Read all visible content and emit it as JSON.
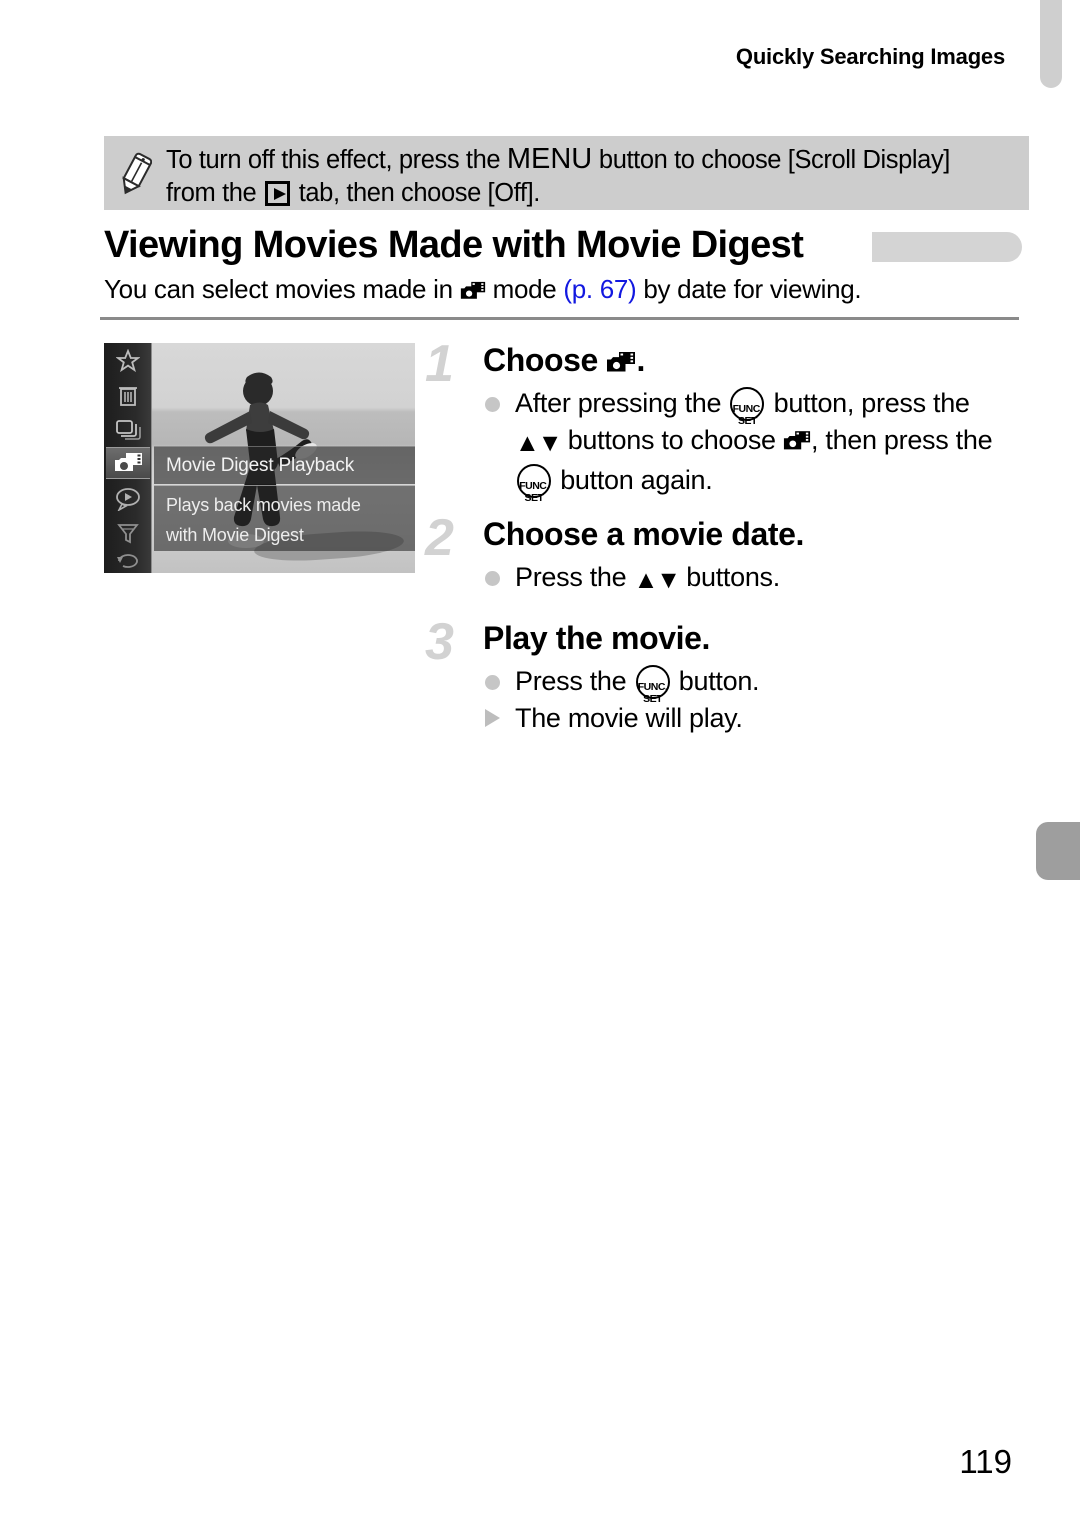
{
  "header": {
    "running_title": "Quickly Searching Images"
  },
  "note": {
    "icon": "pencil-icon",
    "line1_pre": "To turn off this effect, press the ",
    "menu_word": "MENU",
    "line1_post": " button to choose [Scroll Display]",
    "line2_pre": "from the ",
    "tab_icon": "playback-tab-icon",
    "line2_post": " tab, then choose [Off]."
  },
  "section": {
    "heading": "Viewing Movies Made with Movie Digest",
    "sub_pre": "You can select movies made in ",
    "sub_mode_icon": "movie-digest-icon",
    "sub_mid": " mode ",
    "page_ref": "(p. 67)",
    "sub_post": " by date for viewing."
  },
  "camera_screen": {
    "menu_title": "Movie Digest Playback",
    "menu_description_line1": "Plays back movies made",
    "menu_description_line2": "with Movie Digest",
    "sidebar_icons": [
      "star-icon",
      "trash-icon",
      "image-stack-icon",
      "movie-digest-icon",
      "speech-bubble-play-icon",
      "funnel-filter-icon",
      "rotate-icon"
    ]
  },
  "steps": [
    {
      "number": "1",
      "title_pre": "Choose ",
      "title_icon": "movie-digest-icon",
      "title_post": ".",
      "lines": [
        {
          "bullet": "dot",
          "segments": [
            {
              "t": "text",
              "v": "After pressing the "
            },
            {
              "t": "funcset",
              "v": "FUNC./SET"
            },
            {
              "t": "text",
              "v": " button, press the"
            }
          ]
        },
        {
          "bullet": "none",
          "segments": [
            {
              "t": "arrows",
              "v": "▲▼"
            },
            {
              "t": "text",
              "v": " buttons to choose "
            },
            {
              "t": "movie-digest-icon",
              "v": ""
            },
            {
              "t": "text",
              "v": ", then press the"
            }
          ]
        },
        {
          "bullet": "none",
          "segments": [
            {
              "t": "funcset",
              "v": "FUNC./SET"
            },
            {
              "t": "text",
              "v": " button again."
            }
          ]
        }
      ]
    },
    {
      "number": "2",
      "title_pre": "Choose a movie date.",
      "title_icon": "",
      "title_post": "",
      "lines": [
        {
          "bullet": "dot",
          "segments": [
            {
              "t": "text",
              "v": "Press the "
            },
            {
              "t": "arrows",
              "v": "▲▼"
            },
            {
              "t": "text",
              "v": " buttons."
            }
          ]
        }
      ]
    },
    {
      "number": "3",
      "title_pre": "Play the movie.",
      "title_icon": "",
      "title_post": "",
      "lines": [
        {
          "bullet": "dot",
          "segments": [
            {
              "t": "text",
              "v": "Press the "
            },
            {
              "t": "funcset",
              "v": "FUNC./SET"
            },
            {
              "t": "text",
              "v": " button."
            }
          ]
        },
        {
          "bullet": "tri",
          "segments": [
            {
              "t": "text",
              "v": "The movie will play."
            }
          ]
        }
      ]
    }
  ],
  "footer": {
    "page_number": "119"
  },
  "colors": {
    "note_background": "#cdcdcd",
    "heading_bar": "#d4d4d4",
    "page_ref_link": "#1218e0",
    "step_number": "#d2d2d2",
    "tab_top": "#cfcfcf",
    "tab_mid": "#9e9e9e"
  }
}
